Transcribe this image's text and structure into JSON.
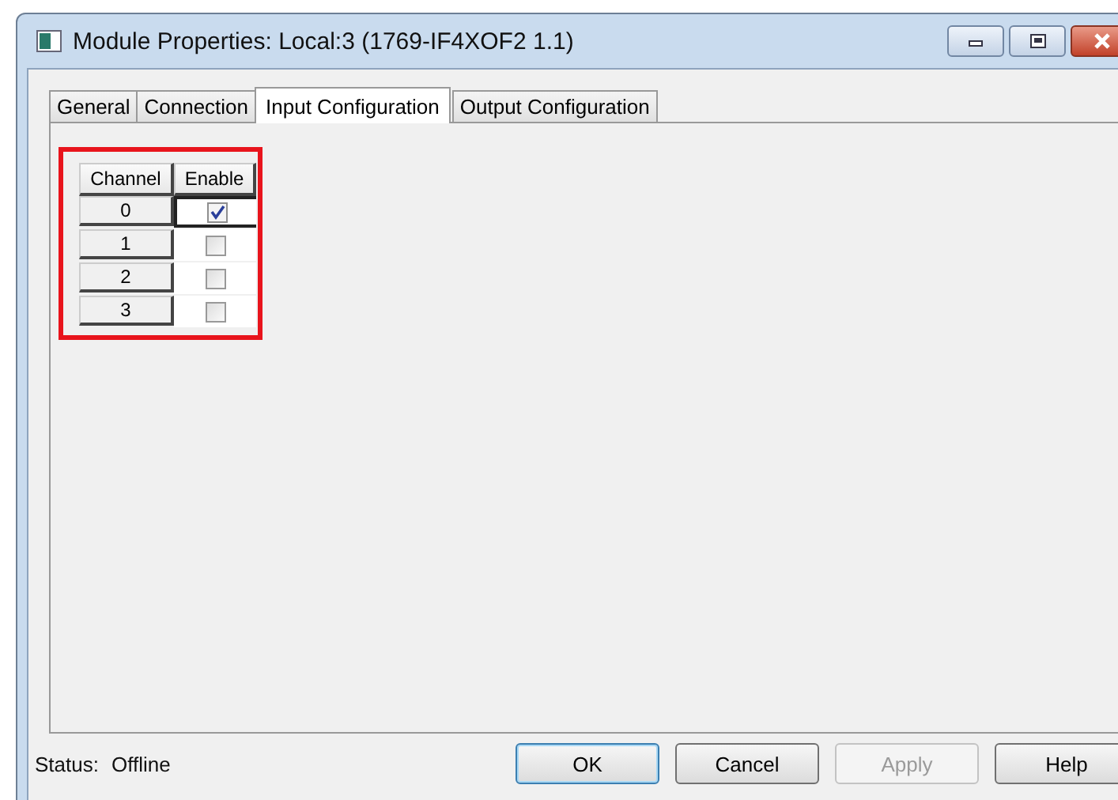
{
  "window": {
    "title": "Module Properties: Local:3 (1769-IF4XOF2 1.1)"
  },
  "tabs": [
    {
      "label": "General",
      "selected": false
    },
    {
      "label": "Connection",
      "selected": false
    },
    {
      "label": "Input Configuration",
      "selected": true
    },
    {
      "label": "Output Configuration",
      "selected": false
    }
  ],
  "table": {
    "columns": [
      "Channel",
      "Enable"
    ],
    "rows": [
      {
        "channel": "0",
        "enabled": true,
        "selected": true
      },
      {
        "channel": "1",
        "enabled": false,
        "selected": false
      },
      {
        "channel": "2",
        "enabled": false,
        "selected": false
      },
      {
        "channel": "3",
        "enabled": false,
        "selected": false
      }
    ]
  },
  "status_bar": {
    "label": "Status:",
    "value": "Offline"
  },
  "buttons": [
    {
      "label": "OK",
      "default": true,
      "disabled": false
    },
    {
      "label": "Cancel",
      "default": false,
      "disabled": false
    },
    {
      "label": "Apply",
      "default": false,
      "disabled": true
    },
    {
      "label": "Help",
      "default": false,
      "disabled": false
    }
  ]
}
